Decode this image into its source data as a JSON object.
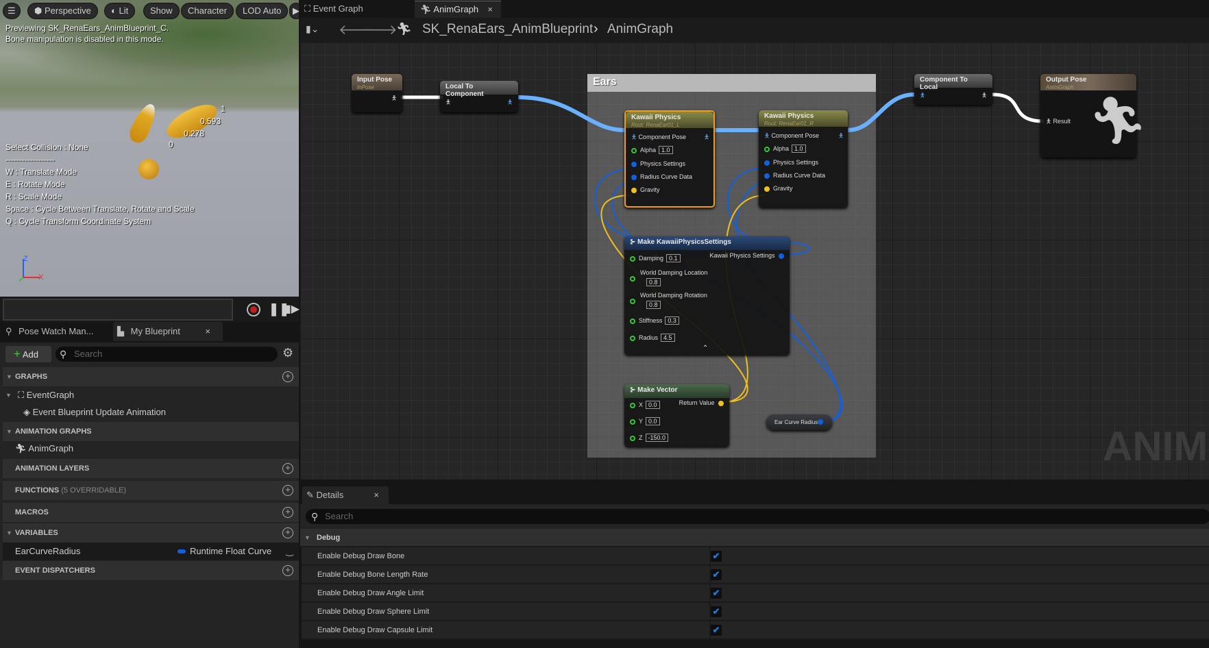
{
  "viewport": {
    "toolbar": [
      "Perspective",
      "Lit",
      "Show",
      "Character",
      "LOD Auto"
    ],
    "preview_lines": [
      "Previewing SK_RenaEars_AnimBlueprint_C.",
      "Bone manipulation is disabled in this mode."
    ],
    "help_lines": [
      "Select Collision : None",
      "------------------",
      "W : Translate Mode",
      "E : Rotate Mode",
      "R : Scale Mode",
      "Space : Cycle Between Translate, Rotate and Scale",
      "Q : Cycle Transform Coordinate System"
    ],
    "bone_labels": [
      "1",
      "0.593",
      "0.278",
      "0"
    ],
    "axis": {
      "z": "Z",
      "x": "X"
    }
  },
  "left_tabs": [
    {
      "label": "Pose Watch Man..."
    },
    {
      "label": "My Blueprint",
      "close": "×"
    }
  ],
  "my_blueprint": {
    "add_label": "Add",
    "search_placeholder": "Search",
    "sections": {
      "graphs": "GRAPHS",
      "animation_graphs": "ANIMATION GRAPHS",
      "animation_layers": "ANIMATION LAYERS",
      "functions": "FUNCTIONS",
      "functions_note": "(5 OVERRIDABLE)",
      "macros": "MACROS",
      "variables": "VARIABLES",
      "event_dispatchers": "EVENT DISPATCHERS"
    },
    "event_graph": "EventGraph",
    "event_item": "Event Blueprint Update Animation",
    "anim_graph": "AnimGraph",
    "variable": {
      "name": "EarCurveRadius",
      "type": "Runtime Float Curve",
      "type_color": "#1060e0"
    }
  },
  "graph_tabs": [
    {
      "label": "Event Graph"
    },
    {
      "label": "AnimGraph",
      "close": "×"
    }
  ],
  "breadcrumb": {
    "blueprint": "SK_RenaEars_AnimBlueprint",
    "sep": "›",
    "graph": "AnimGraph"
  },
  "nodes": {
    "input_pose": {
      "title": "Input Pose",
      "sub": "InPose"
    },
    "local_to_component": {
      "title": "Local To Component"
    },
    "comment": "Ears",
    "kawaii_l": {
      "title": "Kawaii Physics",
      "sub": "Root: RenaEar01_L",
      "pins": [
        "Component Pose",
        "Alpha",
        "Physics Settings",
        "Radius Curve Data",
        "Gravity"
      ],
      "alpha": "1.0"
    },
    "kawaii_r": {
      "title": "Kawaii Physics",
      "sub": "Root: RenaEar01_R",
      "pins": [
        "Component Pose",
        "Alpha",
        "Physics Settings",
        "Radius Curve Data",
        "Gravity"
      ],
      "alpha": "1.0"
    },
    "component_to_local": {
      "title": "Component To Local"
    },
    "output_pose": {
      "title": "Output Pose",
      "sub": "AnimGraph",
      "pin": "Result"
    },
    "make_settings": {
      "title": "Make KawaiiPhysicsSettings",
      "output": "Kawaii Physics Settings",
      "damping": {
        "label": "Damping",
        "value": "0.1"
      },
      "wdl": {
        "label": "World Damping Location",
        "value": "0.8"
      },
      "wdr": {
        "label": "World Damping Rotation",
        "value": "0.8"
      },
      "stiffness": {
        "label": "Stiffness",
        "value": "0.3"
      },
      "radius": {
        "label": "Radius",
        "value": "4.5"
      }
    },
    "make_vector": {
      "title": "Make Vector",
      "output": "Return Value",
      "x": {
        "label": "X",
        "value": "0.0"
      },
      "y": {
        "label": "Y",
        "value": "0.0"
      },
      "z": {
        "label": "Z",
        "value": "-150.0"
      }
    },
    "ear_curve_radius": {
      "title": "Ear Curve Radius"
    }
  },
  "watermark": "ANIMATION",
  "details": {
    "tab": "Details",
    "close": "×",
    "search_placeholder": "Search",
    "category": "Debug",
    "rows": [
      {
        "label": "Enable Debug Draw Bone",
        "checked": true
      },
      {
        "label": "Enable Debug Bone Length Rate",
        "checked": true
      },
      {
        "label": "Enable Debug Draw Angle Limit",
        "checked": true
      },
      {
        "label": "Enable Debug Draw Sphere Limit",
        "checked": true
      },
      {
        "label": "Enable Debug Draw Capsule Limit",
        "checked": true
      }
    ],
    "check": "✔"
  },
  "colors": {
    "pose_wire": "#6ab0ff",
    "struct_wire": "#1060e0",
    "vector_wire": "#f0c020",
    "selected": "#f5a000"
  }
}
